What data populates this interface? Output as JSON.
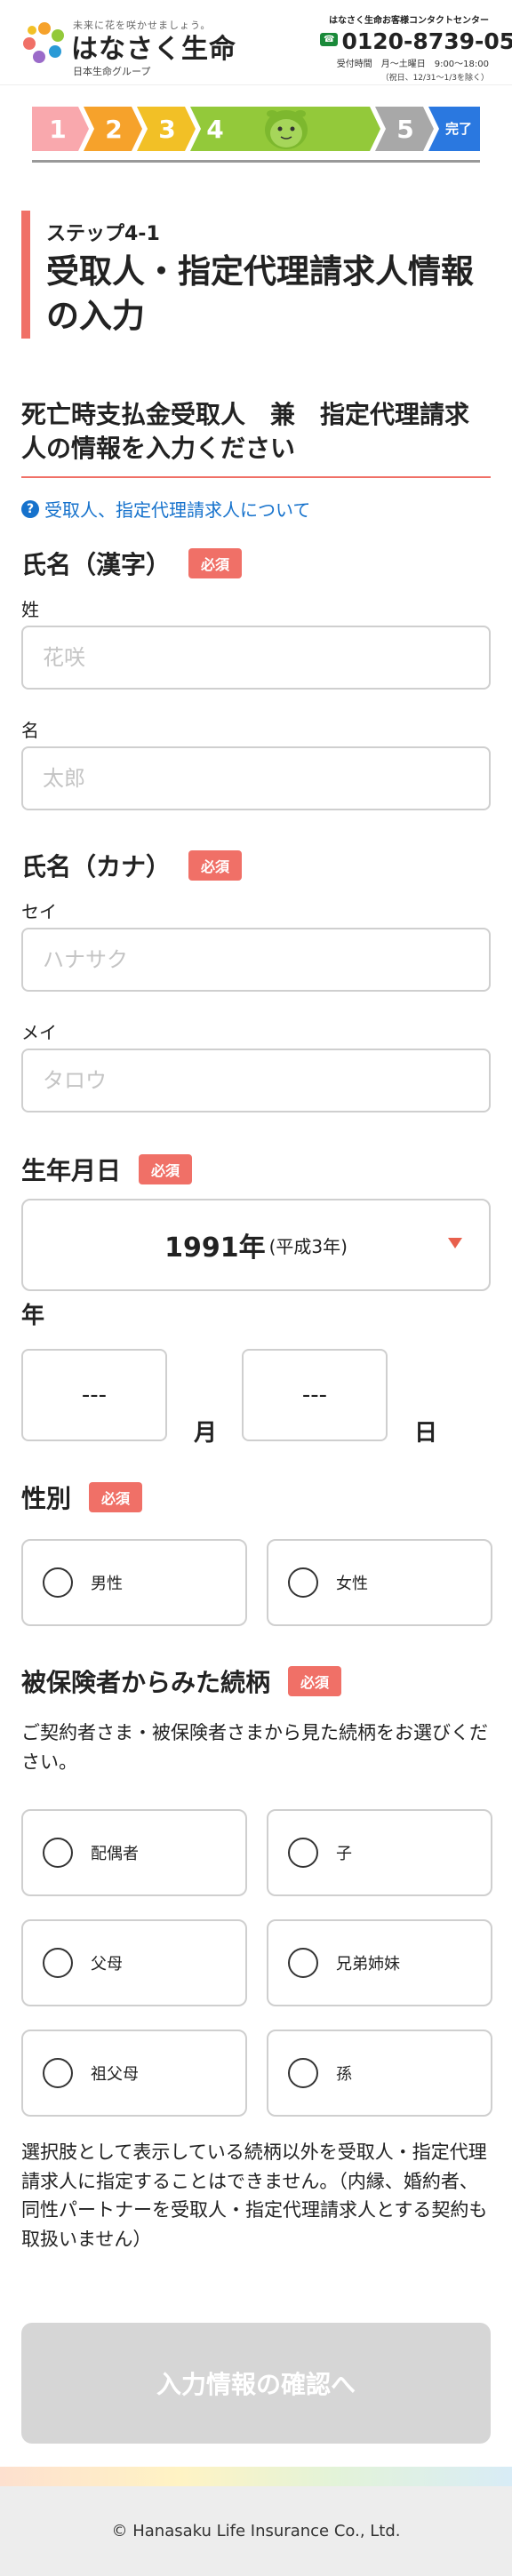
{
  "header": {
    "tagline": "未来に花を咲かせましょう。",
    "company_name": "はなさく生命",
    "group_name": "日本生命グループ",
    "contact_title": "はなさく生命お客様コンタクトセンター",
    "freedial_label": "フリーダイヤル",
    "phone": "0120-8739-05",
    "hours": "受付時間　月〜土曜日　9:00〜18:00",
    "hours_note": "（祝日、12/31〜1/3を除く）"
  },
  "progress": {
    "steps": [
      "1",
      "2",
      "3",
      "4",
      "5",
      "完了"
    ],
    "current_step": 4,
    "colors": {
      "1": "#f9a8ad",
      "2": "#f6a22b",
      "3": "#f2c026",
      "4": "#93c93a",
      "5": "#a8a8a8",
      "done": "#2a78e0"
    }
  },
  "title": {
    "step_label": "ステップ4-1",
    "page_title": "受取人・指定代理請求人情報の入力"
  },
  "section_title": "死亡時支払金受取人　兼　指定代理請求人の情報を入力ください",
  "help_link": "受取人、指定代理請求人について",
  "required_label": "必須",
  "name_kanji": {
    "label": "氏名（漢字）",
    "last_label": "姓",
    "last_placeholder": "花咲",
    "first_label": "名",
    "first_placeholder": "太郎"
  },
  "name_kana": {
    "label": "氏名（カナ）",
    "last_label": "セイ",
    "last_placeholder": "ハナサク",
    "first_label": "メイ",
    "first_placeholder": "タロウ"
  },
  "birthdate": {
    "label": "生年月日",
    "year_value": "1991年",
    "year_era": "(平成3年)",
    "year_unit": "年",
    "month_value": "---",
    "month_unit": "月",
    "day_value": "---",
    "day_unit": "日"
  },
  "gender": {
    "label": "性別",
    "options": [
      "男性",
      "女性"
    ]
  },
  "relationship": {
    "label": "被保険者からみた続柄",
    "description": "ご契約者さま・被保険者さまから見た続柄をお選びください。",
    "options": [
      "配偶者",
      "子",
      "父母",
      "兄弟姉妹",
      "祖父母",
      "孫"
    ],
    "note": "選択肢として表示している続柄以外を受取人・指定代理請求人に指定することはできません。（内縁、婚約者、同性パートナーを受取人・指定代理請求人とする契約も取扱いません）"
  },
  "submit_label": "入力情報の確認へ",
  "footer": {
    "copyright": "© Hanasaku Life Insurance Co., Ltd."
  }
}
